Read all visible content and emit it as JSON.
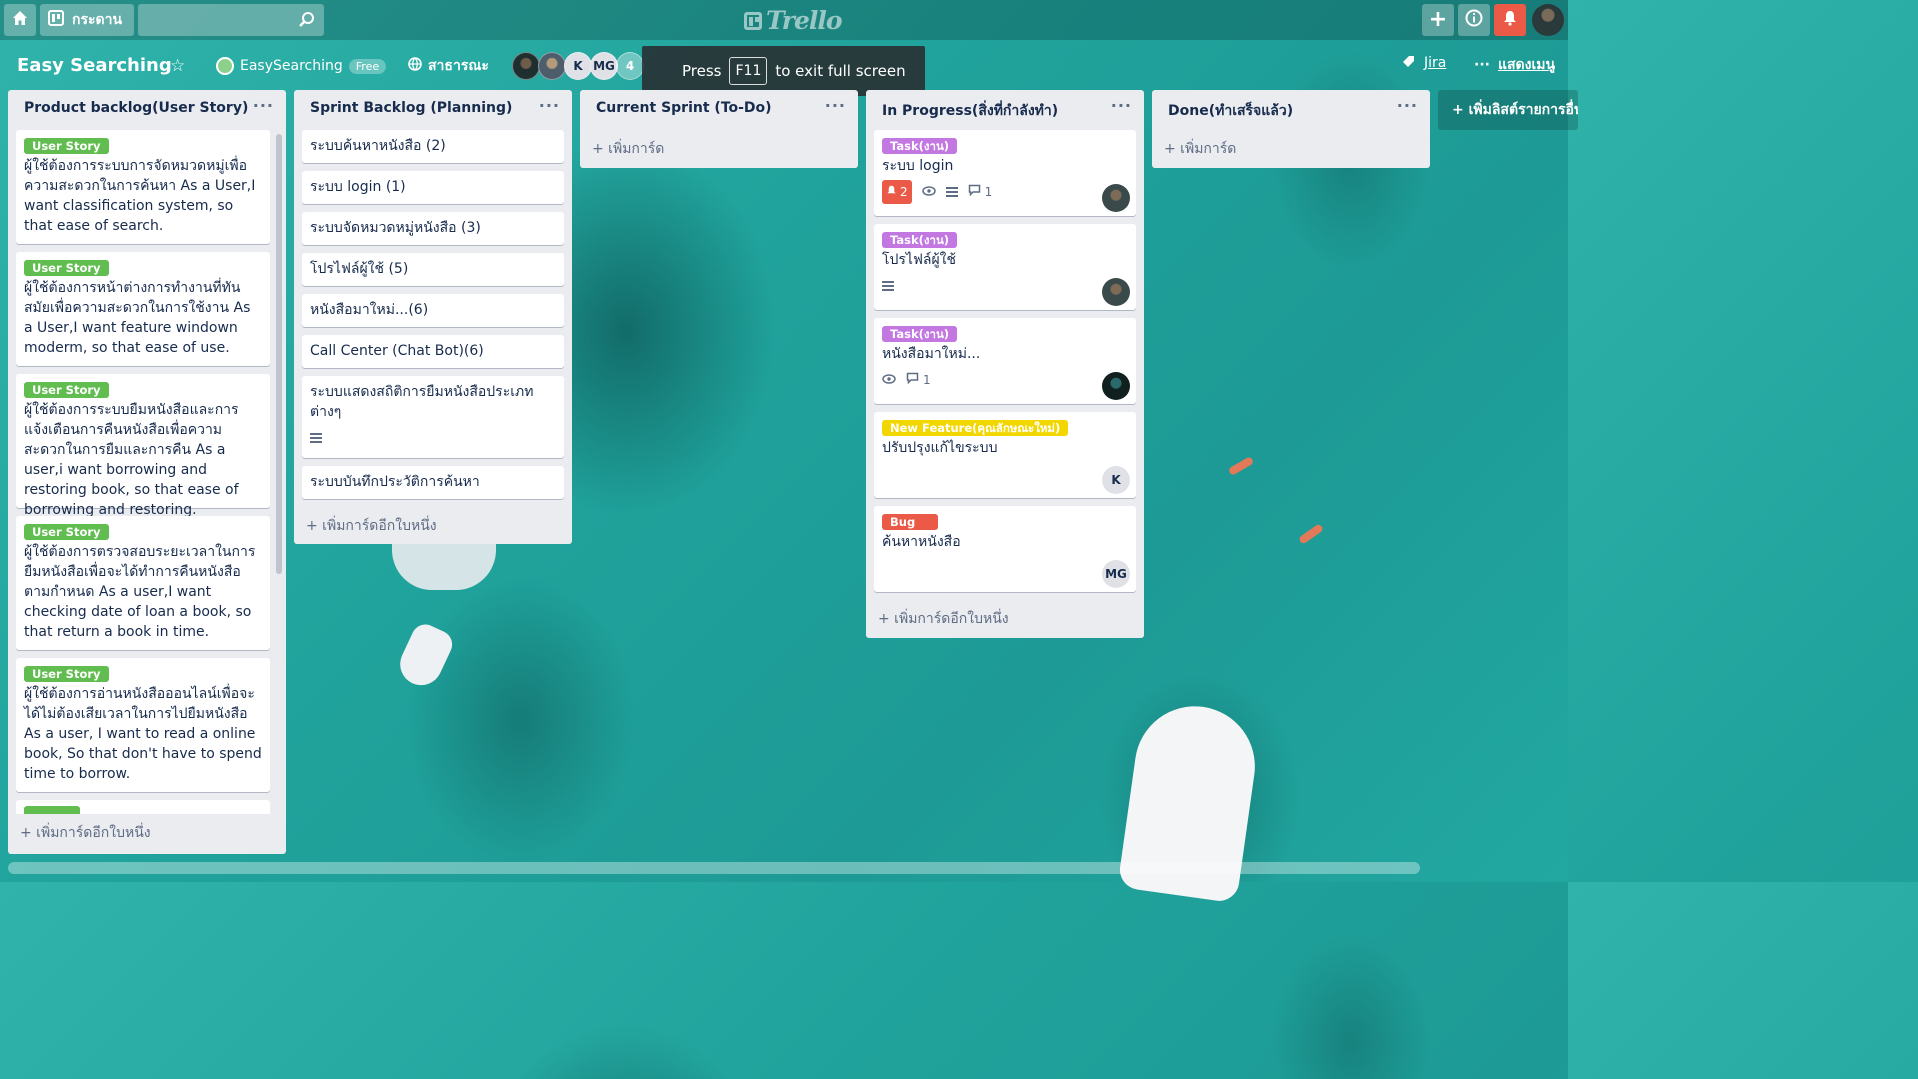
{
  "header": {
    "boards_label": "กระดาน",
    "search_placeholder": "",
    "logo_text": "Trello"
  },
  "board": {
    "title": "Easy Searching",
    "team_name": "EasySearching",
    "plan_badge": "Free",
    "visibility": "สาธารณะ",
    "members": [
      "",
      "",
      "K",
      "MG"
    ],
    "member_more": "4",
    "jira_label": "Jira",
    "menu_label": "แสดงเมนู",
    "add_list": "+ เพิ่มลิสต์รายการอื่น"
  },
  "toast": {
    "pre": "Press",
    "key": "F11",
    "post": "to exit full screen"
  },
  "lists": [
    {
      "title": "Product backlog(User Story)",
      "cards": [
        {
          "label": "User Story",
          "text": "ผู้ใช้ต้องการระบบการจัดหมวดหมู่เพื่อความสะดวกในการค้นหา As a User,I want classification system, so that ease of search."
        },
        {
          "label": "User Story",
          "text": "ผู้ใช้ต้องการหน้าต่างการทำงานที่ทันสมัยเพื่อความสะดวกในการใช้งาน As a User,I want feature windown moderm, so that ease of use."
        },
        {
          "label": "User Story",
          "text": "ผู้ใช้ต้องการระบบยืมหนังสือและการแจ้งเตือนการคืนหนังสือเพื่อความสะดวกในการยืมและการคืน As a user,i want borrowing and restoring book, so that ease of borrowing and restoring."
        },
        {
          "label": "User Story",
          "text": "ผู้ใช้ต้องการตรวจสอบระยะเวลาในการยืมหนังสือเพื่อจะได้ทำการคืนหนังสือตามกำหนด As a user,I want checking date of loan a book, so that return a book in time."
        },
        {
          "label": "User Story",
          "text": "ผู้ใช้ต้องการอ่านหนังสือออนไลน์เพื่อจะได้ไม่ต้องเสียเวลาในการไปยืมหนังสือ As a user, I want to read a online book, So that don't have to spend time to borrow."
        }
      ],
      "add": "+ เพิ่มการ์ดอีกใบหนึ่ง"
    },
    {
      "title": "Sprint Backlog (Planning)",
      "cards": [
        {
          "text": "ระบบค้นหาหนังสือ (2)"
        },
        {
          "text": "ระบบ login (1)"
        },
        {
          "text": "ระบบจัดหมวดหมู่หนังสือ (3)"
        },
        {
          "text": "โปรไฟล์ผู้ใช้ (5)"
        },
        {
          "text": "หนังสือมาใหม่...(6)"
        },
        {
          "text": "Call Center (Chat Bot)(6)"
        },
        {
          "text": "ระบบแสดงสถิติการยืมหนังสือประเภทต่างๆ"
        },
        {
          "text": "ระบบบันทึกประวัติการค้นหา"
        }
      ],
      "add": "+ เพิ่มการ์ดอีกใบหนึ่ง"
    },
    {
      "title": "Current Sprint (To-Do)",
      "add": "+ เพิ่มการ์ด"
    },
    {
      "title": "In Progress(สิ่งที่กำลังทำ)",
      "cards": [
        {
          "label": "Task(งาน)",
          "text": "ระบบ login",
          "due": "2",
          "comments": "1"
        },
        {
          "label": "Task(งาน)",
          "text": "โปรไฟล์ผู้ใช้"
        },
        {
          "label": "Task(งาน)",
          "text": "หนังสือมาใหม่...",
          "comments": "1"
        },
        {
          "label": "New Feature(คุณลักษณะใหม่)",
          "text": "ปรับปรุงแก้ไขระบบ",
          "member": "K"
        },
        {
          "label": "Bug",
          "text": "ค้นหาหนังสือ",
          "member": "MG"
        }
      ],
      "add": "+ เพิ่มการ์ดอีกใบหนึ่ง"
    },
    {
      "title": "Done(ทำเสร็จแล้ว)",
      "add": "+ เพิ่มการ์ด"
    }
  ],
  "colors": {
    "label_green": "#61bd4f",
    "label_purple": "#c377e0",
    "label_yellow": "#f2d600",
    "label_red": "#eb5a46",
    "notification": "#eb5a46"
  },
  "icons": [
    "home-icon",
    "board-icon",
    "search-icon",
    "plus-icon",
    "info-icon",
    "bell-icon",
    "star-icon",
    "globe-icon",
    "butler-icon",
    "ellipsis-icon",
    "eye-icon",
    "description-icon",
    "comment-icon",
    "clock-icon"
  ]
}
